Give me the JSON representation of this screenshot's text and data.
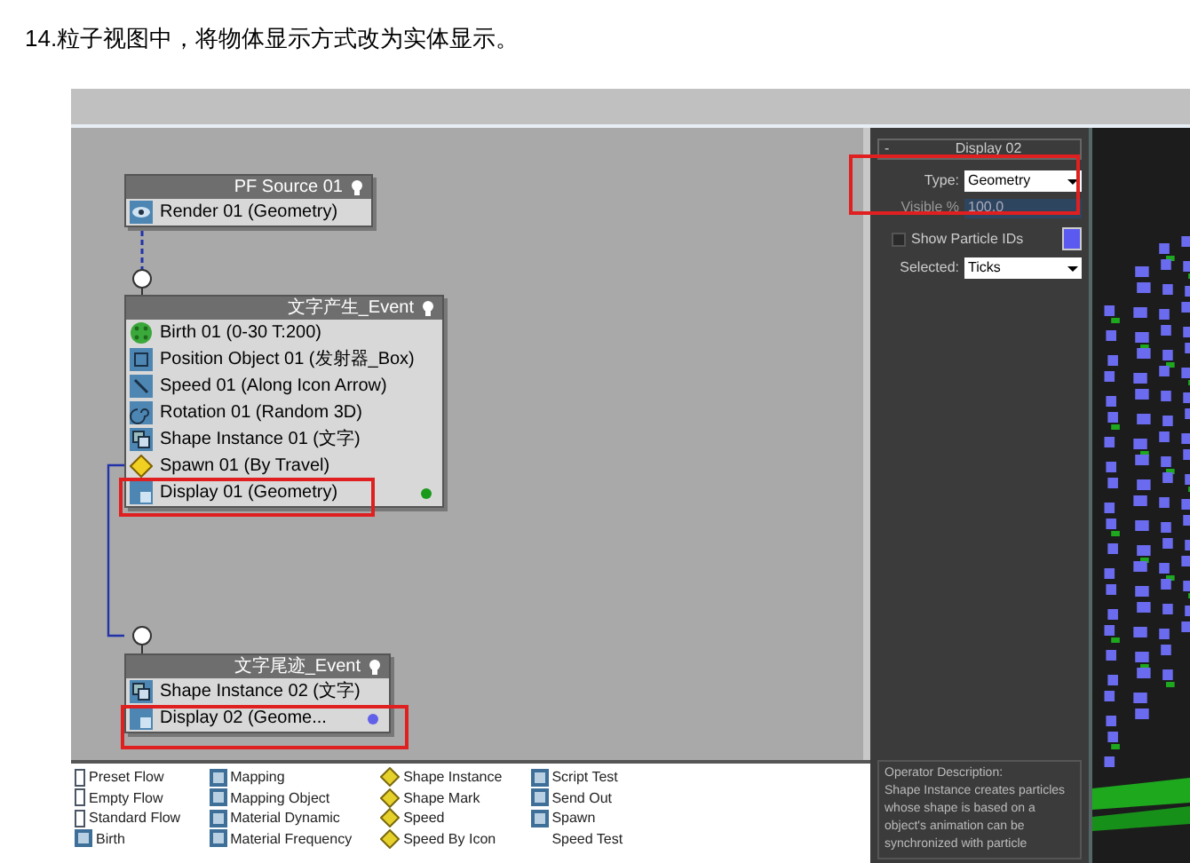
{
  "caption": "14.粒子视图中，将物体显示方式改为实体显示。",
  "nodes": [
    {
      "title": "PF Source 01",
      "operators": [
        {
          "label": "Render 01 (Geometry)",
          "kind": "render"
        }
      ]
    },
    {
      "title": "文字产生_Event",
      "color": "#1a9a1a",
      "operators": [
        {
          "label": "Birth 01 (0-30 T:200)",
          "kind": "birth"
        },
        {
          "label": "Position Object 01 (发射器_Box)",
          "kind": "position"
        },
        {
          "label": "Speed 01 (Along Icon Arrow)",
          "kind": "speed"
        },
        {
          "label": "Rotation 01 (Random 3D)",
          "kind": "rotation"
        },
        {
          "label": "Shape Instance 01 (文字)",
          "kind": "shape"
        },
        {
          "label": "Spawn 01 (By Travel)",
          "kind": "spawn"
        },
        {
          "label": "Display 01 (Geometry)",
          "kind": "display"
        }
      ]
    },
    {
      "title": "文字尾迹_Event",
      "color": "#6060e8",
      "operators": [
        {
          "label": "Shape Instance 02 (文字)",
          "kind": "shape"
        },
        {
          "label": "Display 02 (Geome...",
          "kind": "display"
        }
      ]
    }
  ],
  "parameters": {
    "title": "Display 02",
    "collapse": "-",
    "type_label": "Type:",
    "type_value": "Geometry",
    "visible_label": "Visible %",
    "visible_value": "100.0",
    "show_ids_label": "Show Particle IDs",
    "show_ids_checked": false,
    "selected_label": "Selected:",
    "selected_value": "Ticks"
  },
  "depot": [
    [
      {
        "label": "Preset Flow",
        "kind": "flow"
      },
      {
        "label": "Empty Flow",
        "kind": "flow"
      },
      {
        "label": "Standard Flow",
        "kind": "flow"
      },
      {
        "label": "Birth",
        "kind": "operator"
      }
    ],
    [
      {
        "label": "Mapping",
        "kind": "operator"
      },
      {
        "label": "Mapping Object",
        "kind": "operator"
      },
      {
        "label": "Material Dynamic",
        "kind": "operator"
      },
      {
        "label": "Material Frequency",
        "kind": "operator"
      }
    ],
    [
      {
        "label": "Shape Instance",
        "kind": "diamond"
      },
      {
        "label": "Shape Mark",
        "kind": "diamond"
      },
      {
        "label": "Speed",
        "kind": "diamond"
      },
      {
        "label": "Speed By Icon",
        "kind": "diamond"
      }
    ],
    [
      {
        "label": "Script Test",
        "kind": "operator"
      },
      {
        "label": "Send Out",
        "kind": "operator"
      },
      {
        "label": "Spawn",
        "kind": "operator"
      },
      {
        "label": "Speed Test",
        "kind": "plain"
      }
    ]
  ],
  "description": {
    "title": "Operator Description:",
    "lines": [
      "Shape Instance creates particles",
      "whose shape is based on a",
      "object's animation can be",
      "synchronized with particle"
    ]
  }
}
